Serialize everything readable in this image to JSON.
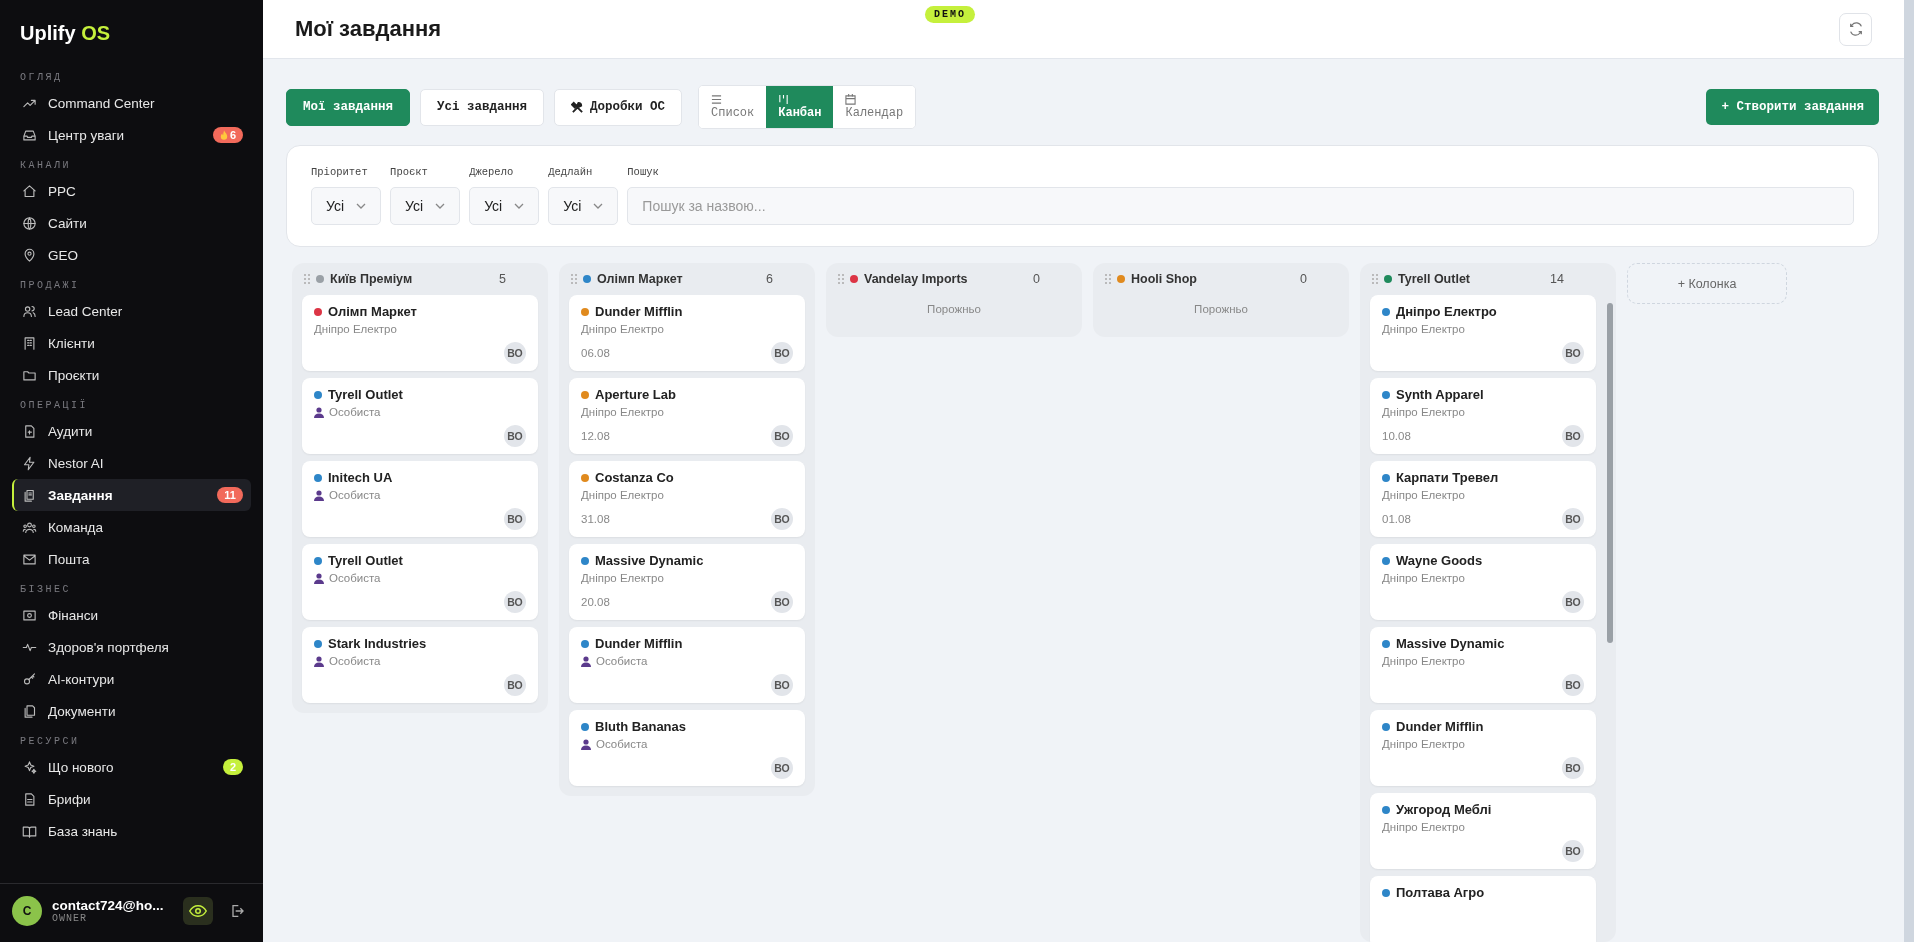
{
  "sidebar": {
    "logo": {
      "name": "Uplify",
      "suffix": "OS"
    },
    "sections": [
      {
        "title": "ОГЛЯД",
        "items": [
          {
            "label": "Command Center",
            "selected": false
          },
          {
            "label": "Центр уваги",
            "selected": false,
            "badge": {
              "text": "6",
              "color": "#f26a5b",
              "fire": true
            }
          }
        ]
      },
      {
        "title": "КАНАЛИ",
        "items": [
          {
            "label": "PPC",
            "selected": false
          },
          {
            "label": "Сайти",
            "selected": false
          },
          {
            "label": "GEO",
            "selected": false
          }
        ]
      },
      {
        "title": "ПРОДАЖІ",
        "items": [
          {
            "label": "Lead Center",
            "selected": false
          },
          {
            "label": "Клієнти",
            "selected": false
          },
          {
            "label": "Проєкти",
            "selected": false
          }
        ]
      },
      {
        "title": "ОПЕРАЦІЇ",
        "items": [
          {
            "label": "Аудити",
            "selected": false
          },
          {
            "label": "Nestor AI",
            "selected": false
          },
          {
            "label": "Завдання",
            "selected": true,
            "badge": {
              "text": "11",
              "color": "#f26a5b",
              "fire": false
            }
          },
          {
            "label": "Команда",
            "selected": false
          },
          {
            "label": "Пошта",
            "selected": false
          }
        ]
      },
      {
        "title": "БІЗНЕС",
        "items": [
          {
            "label": "Фінанси",
            "selected": false
          },
          {
            "label": "Здоров'я портфеля",
            "selected": false
          },
          {
            "label": "AI-контури",
            "selected": false
          },
          {
            "label": "Документи",
            "selected": false
          }
        ]
      },
      {
        "title": "РЕСУРСИ",
        "items": [
          {
            "label": "Що нового",
            "selected": false,
            "badge": {
              "text": "2",
              "color": "#c5f03c",
              "fire": false
            }
          },
          {
            "label": "Брифи",
            "selected": false
          },
          {
            "label": "База знань",
            "selected": false
          }
        ]
      }
    ],
    "user": {
      "avatar": "C",
      "email": "contact724@ho...",
      "role": "OWNER"
    }
  },
  "header": {
    "title": "Мої завдання",
    "badge": "DEMO"
  },
  "toolbar": {
    "scopes": [
      {
        "label": "Мої завдання",
        "selected": true
      },
      {
        "label": "Усі завдання",
        "selected": false
      },
      {
        "label": "Доробки ОС",
        "selected": false,
        "kind": "tools"
      }
    ],
    "views": [
      {
        "label": "Список",
        "selected": false,
        "kind": "list"
      },
      {
        "label": "Канбан",
        "selected": true,
        "kind": "kanban"
      },
      {
        "label": "Календар",
        "selected": false,
        "kind": "calendar"
      }
    ],
    "create_button": "+ Створити завдання"
  },
  "filters": [
    {
      "label": "Пріоритет",
      "value": "Усі"
    },
    {
      "label": "Проєкт",
      "value": "Усі"
    },
    {
      "label": "Джерело",
      "value": "Усі"
    },
    {
      "label": "Дедлайн",
      "value": "Усі"
    }
  ],
  "search": {
    "label": "Пошук",
    "placeholder": "Пошук за назвою..."
  },
  "columns": [
    {
      "title": "Київ Преміум",
      "color": "#9aa0a6",
      "count": "5",
      "cards": [
        {
          "title": "Олімп Маркет",
          "color": "#dc3545",
          "kind": "client",
          "subtitle": "Дніпро Електро",
          "assignee": "ВО"
        },
        {
          "title": "Tyrell Outlet",
          "color": "#2e86c8",
          "kind": "personal",
          "subtitle": "Особиста",
          "assignee": "ВО"
        },
        {
          "title": "Initech UA",
          "color": "#2e86c8",
          "kind": "personal",
          "subtitle": "Особиста",
          "assignee": "ВО"
        },
        {
          "title": "Tyrell Outlet",
          "color": "#2e86c8",
          "kind": "personal",
          "subtitle": "Особиста",
          "assignee": "ВО"
        },
        {
          "title": "Stark Industries",
          "color": "#2e86c8",
          "kind": "personal",
          "subtitle": "Особиста",
          "assignee": "ВО"
        }
      ]
    },
    {
      "title": "Олімп Маркет",
      "color": "#2e86c8",
      "count": "6",
      "cards": [
        {
          "title": "Dunder Mifflin",
          "color": "#e08a1e",
          "kind": "client",
          "subtitle": "Дніпро Електро",
          "date": "06.08",
          "assignee": "ВО"
        },
        {
          "title": "Aperture Lab",
          "color": "#e08a1e",
          "kind": "client",
          "subtitle": "Дніпро Електро",
          "date": "12.08",
          "assignee": "ВО"
        },
        {
          "title": "Costanza Co",
          "color": "#e08a1e",
          "kind": "client",
          "subtitle": "Дніпро Електро",
          "date": "31.08",
          "assignee": "ВО"
        },
        {
          "title": "Massive Dynamic",
          "color": "#2e86c8",
          "kind": "client",
          "subtitle": "Дніпро Електро",
          "date": "20.08",
          "assignee": "ВО"
        },
        {
          "title": "Dunder Mifflin",
          "color": "#2e86c8",
          "kind": "personal",
          "subtitle": "Особиста",
          "assignee": "ВО"
        },
        {
          "title": "Bluth Bananas",
          "color": "#2e86c8",
          "kind": "personal",
          "subtitle": "Особиста",
          "assignee": "ВО"
        }
      ]
    },
    {
      "title": "Vandelay Imports",
      "color": "#dc3545",
      "count": "0",
      "empty_text": "Порожньо"
    },
    {
      "title": "Hooli Shop",
      "color": "#e08a1e",
      "count": "0",
      "empty_text": "Порожньо"
    },
    {
      "title": "Tyrell Outlet",
      "color": "#1f8a5c",
      "count": "14",
      "cards": [
        {
          "title": "Дніпро Електро",
          "color": "#2e86c8",
          "kind": "client",
          "subtitle": "Дніпро Електро",
          "assignee": "ВО"
        },
        {
          "title": "Synth Apparel",
          "color": "#2e86c8",
          "kind": "client",
          "subtitle": "Дніпро Електро",
          "date": "10.08",
          "assignee": "ВО"
        },
        {
          "title": "Карпати Тревел",
          "color": "#2e86c8",
          "kind": "client",
          "subtitle": "Дніпро Електро",
          "date": "01.08",
          "assignee": "ВО"
        },
        {
          "title": "Wayne Goods",
          "color": "#2e86c8",
          "kind": "client",
          "subtitle": "Дніпро Електро",
          "assignee": "ВО"
        },
        {
          "title": "Massive Dynamic",
          "color": "#2e86c8",
          "kind": "client",
          "subtitle": "Дніпро Електро",
          "assignee": "ВО"
        },
        {
          "title": "Dunder Mifflin",
          "color": "#2e86c8",
          "kind": "client",
          "subtitle": "Дніпро Електро",
          "assignee": "ВО"
        },
        {
          "title": "Ужгород Меблі",
          "color": "#2e86c8",
          "kind": "client",
          "subtitle": "Дніпро Електро",
          "assignee": "ВО"
        },
        {
          "title": "Полтава Агро",
          "color": "#2e86c8",
          "kind": "partial"
        }
      ]
    }
  ],
  "add_column": "+ Колонка"
}
